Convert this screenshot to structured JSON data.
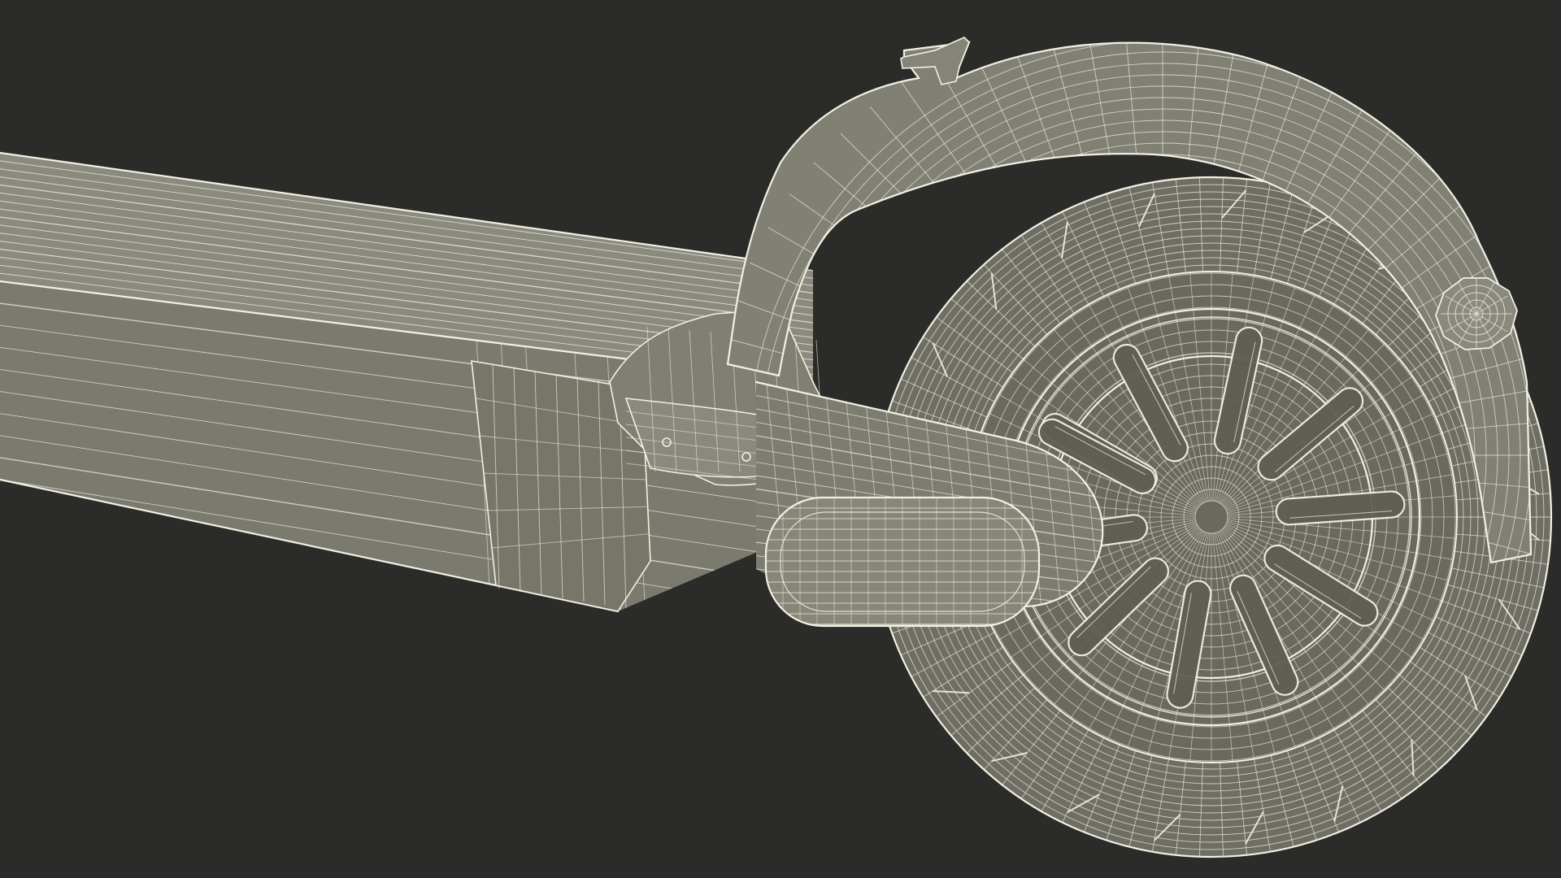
{
  "scene": {
    "background_color": "#2b2b29",
    "surface_color": "#7d7c71",
    "surface_shadow_color": "#5f5e55",
    "surface_light_color": "#8b8a7f",
    "wireframe_color": "#f2f0e2",
    "objects": [
      "scooter-deck",
      "rear-fender",
      "rear-wheel-tire",
      "hub-motor",
      "wheel-spokes",
      "swing-arm",
      "axle-cap",
      "fender-bracket-bolt"
    ]
  }
}
